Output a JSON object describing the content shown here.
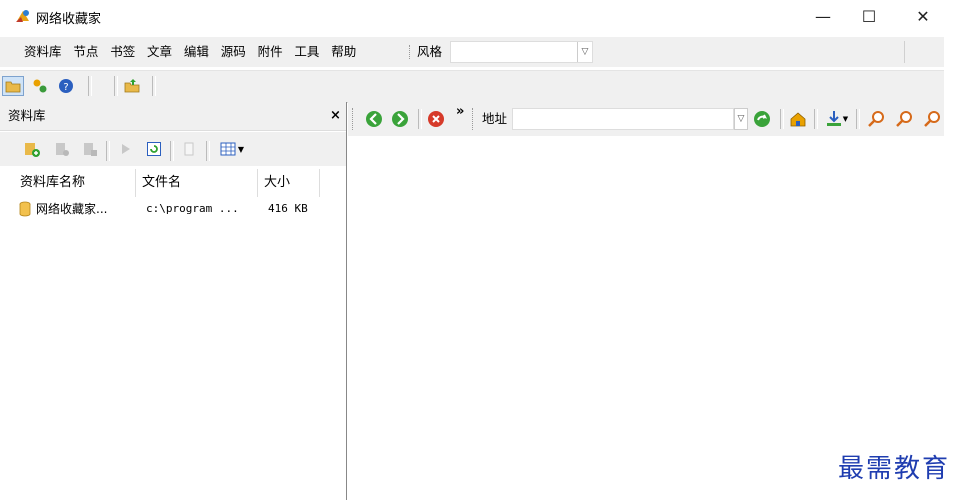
{
  "window": {
    "title": "网络收藏家",
    "controls": {
      "minimize": "—",
      "maximize": "☐",
      "close": "✕"
    }
  },
  "menubar": {
    "items": [
      "资料库",
      "节点",
      "书签",
      "文章",
      "编辑",
      "源码",
      "附件",
      "工具",
      "帮助"
    ],
    "style_label": "风格",
    "style_value": ""
  },
  "left_panel": {
    "title": "资料库",
    "close": "×",
    "columns": [
      "资料库名称",
      "文件名",
      "大小"
    ],
    "rows": [
      {
        "name": "网络收藏家...",
        "file": "c:\\program ...",
        "size": "416 KB"
      }
    ]
  },
  "browser_toolbar": {
    "overflow": "»",
    "address_label": "地址",
    "address_value": ""
  },
  "watermark": "最需教育",
  "colors": {
    "chrome": "#f0f0f0",
    "watermark": "#1f3db0"
  }
}
